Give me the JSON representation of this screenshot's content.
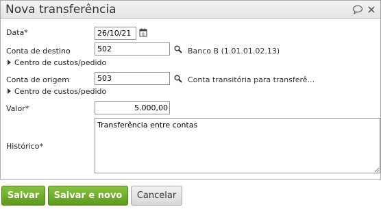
{
  "window": {
    "title": "Nova transferência",
    "icons": [
      "chat-bubble-icon",
      "close-icon"
    ]
  },
  "form": {
    "data_label": "Data*",
    "data_value": "26/10/21",
    "conta_destino_label": "Conta de destino",
    "conta_destino_value": "502",
    "conta_destino_desc": "Banco B (1.01.01.02.13)",
    "centro_custos_label": "Centro de custos/pedido",
    "conta_origem_label": "Conta de origem",
    "conta_origem_value": "503",
    "conta_origem_desc": "Conta transitória para transferê...",
    "valor_label": "Valor*",
    "valor_value": "5.000,00",
    "historico_label": "Histórico*",
    "historico_value": "Transferência entre contas"
  },
  "buttons": {
    "salvar": "Salvar",
    "salvar_novo": "Salvar e novo",
    "cancelar": "Cancelar"
  },
  "colors": {
    "primary_button": "#6aab27",
    "secondary_button": "#e0e0e0"
  }
}
